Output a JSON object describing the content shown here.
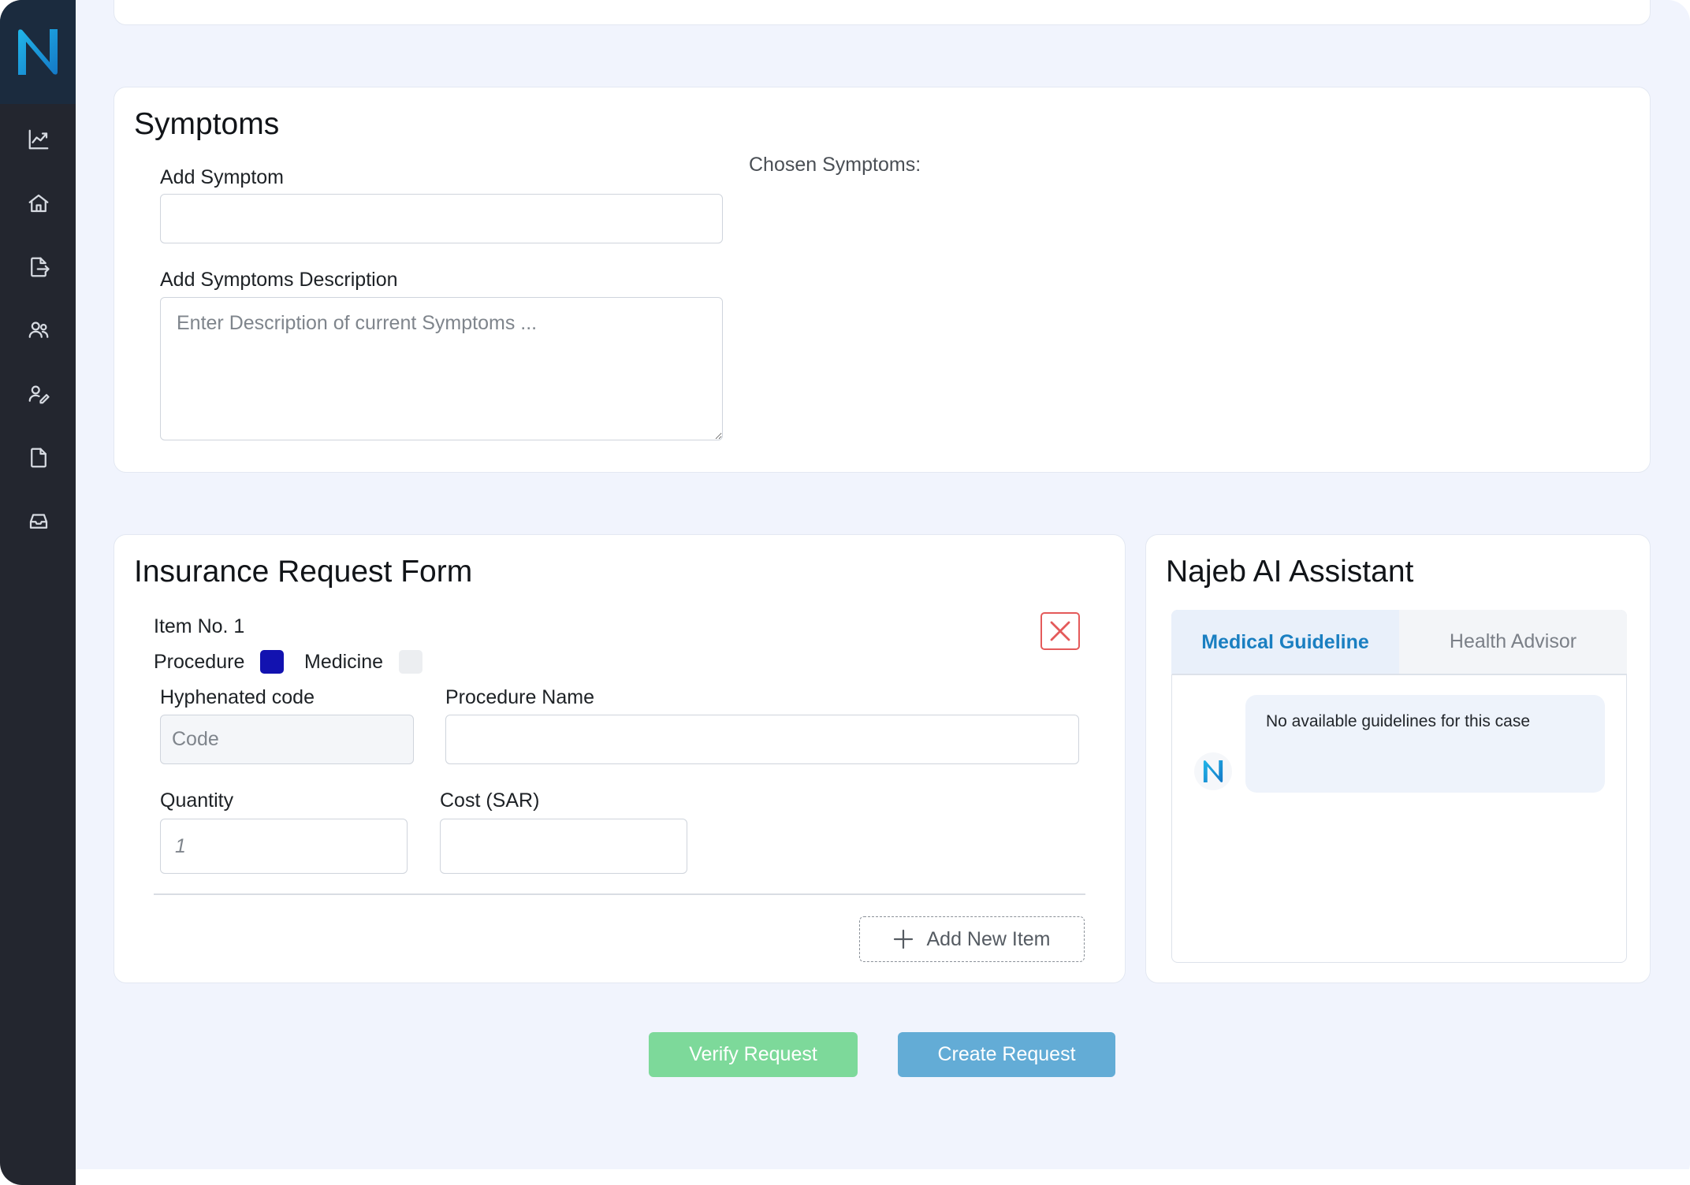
{
  "app": {
    "logo_letter": "N"
  },
  "sidebar": {
    "items": [
      {
        "icon": "chart-line-icon"
      },
      {
        "icon": "home-icon"
      },
      {
        "icon": "file-export-icon"
      },
      {
        "icon": "users-icon"
      },
      {
        "icon": "user-edit-icon"
      },
      {
        "icon": "document-icon"
      },
      {
        "icon": "inbox-icon"
      }
    ]
  },
  "symptoms": {
    "title": "Symptoms",
    "add_symptom_label": "Add Symptom",
    "add_symptom_value": "",
    "description_label": "Add Symptoms Description",
    "description_placeholder": "Enter Description of current Symptoms ...",
    "chosen_label": "Chosen Symptoms:"
  },
  "insurance_form": {
    "title": "Insurance Request Form",
    "item_label": "Item No. 1",
    "procedure_label": "Procedure",
    "medicine_label": "Medicine",
    "procedure_checked": true,
    "medicine_checked": false,
    "hyphenated_code_label": "Hyphenated code",
    "code_placeholder": "Code",
    "procedure_name_label": "Procedure Name",
    "procedure_name_value": "",
    "quantity_label": "Quantity",
    "quantity_placeholder": "1",
    "cost_label": "Cost (SAR)",
    "cost_value": "",
    "add_item_label": "Add New Item"
  },
  "assistant": {
    "title": "Najeb AI Assistant",
    "tabs": [
      {
        "label": "Medical Guideline",
        "active": true
      },
      {
        "label": "Health Advisor",
        "active": false
      }
    ],
    "avatar_letter": "N",
    "message": "No available guidelines for this case"
  },
  "actions": {
    "verify_label": "Verify Request",
    "create_label": "Create Request"
  },
  "colors": {
    "sidebar_bg": "#23262f",
    "accent_blue": "#1a7fc1",
    "verify_green": "#7dd99a",
    "create_blue": "#63acd6",
    "procedure_check": "#1212b0",
    "close_red": "#e45a5a"
  }
}
